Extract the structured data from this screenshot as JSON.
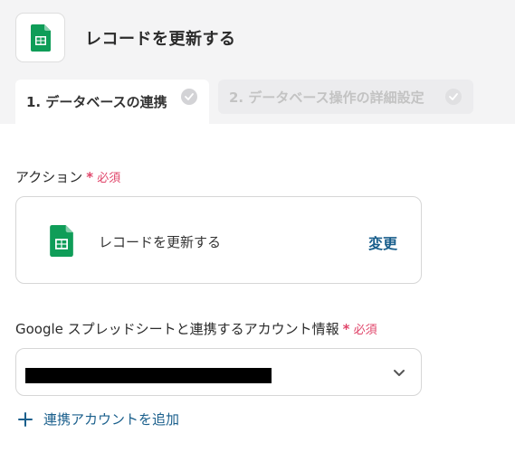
{
  "header": {
    "title": "レコードを更新する",
    "app_icon": "google-sheets-icon"
  },
  "tabs": [
    {
      "label": "1. データベースの連携",
      "state": "active"
    },
    {
      "label": "2. データベース操作の詳細設定",
      "state": "inactive"
    }
  ],
  "action_field": {
    "label": "アクション",
    "required": "必須",
    "required_star": "*",
    "selected_action": "レコードを更新する",
    "change_label": "変更"
  },
  "account_field": {
    "label": "Google スプレッドシートと連携するアカウント情報",
    "required": "必須",
    "required_star": "*",
    "value_redacted": true
  },
  "add_account": {
    "label": "連携アカウントを追加"
  },
  "colors": {
    "accent": "#1a5f8c",
    "required": "#e0456a",
    "sheets_green": "#0f9d58"
  }
}
